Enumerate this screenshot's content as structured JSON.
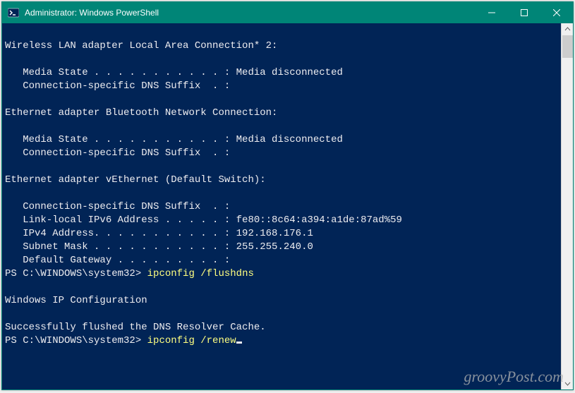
{
  "window": {
    "title": "Administrator: Windows PowerShell"
  },
  "titlebar": {
    "minimize_glyph": "─",
    "maximize_glyph": "☐",
    "close_glyph": "✕"
  },
  "scrollbar": {
    "up_glyph": "▴",
    "down_glyph": "▾"
  },
  "terminal": {
    "section1_header": "Wireless LAN adapter Local Area Connection* 2:",
    "section1_media": "   Media State . . . . . . . . . . . : Media disconnected",
    "section1_dns": "   Connection-specific DNS Suffix  . :",
    "section2_header": "Ethernet adapter Bluetooth Network Connection:",
    "section2_media": "   Media State . . . . . . . . . . . : Media disconnected",
    "section2_dns": "   Connection-specific DNS Suffix  . :",
    "section3_header": "Ethernet adapter vEthernet (Default Switch):",
    "section3_dns": "   Connection-specific DNS Suffix  . :",
    "section3_ipv6": "   Link-local IPv6 Address . . . . . : fe80::8c64:a394:a1de:87ad%59",
    "section3_ipv4": "   IPv4 Address. . . . . . . . . . . : 192.168.176.1",
    "section3_mask": "   Subnet Mask . . . . . . . . . . . : 255.255.240.0",
    "section3_gw": "   Default Gateway . . . . . . . . . :",
    "prompt1_prefix": "PS C:\\WINDOWS\\system32> ",
    "prompt1_cmd": "ipconfig /flushdns",
    "ipconf_header": "Windows IP Configuration",
    "flush_success": "Successfully flushed the DNS Resolver Cache.",
    "prompt2_prefix": "PS C:\\WINDOWS\\system32> ",
    "prompt2_cmd": "ipconfig /renew"
  },
  "watermark": "groovyPost.com"
}
